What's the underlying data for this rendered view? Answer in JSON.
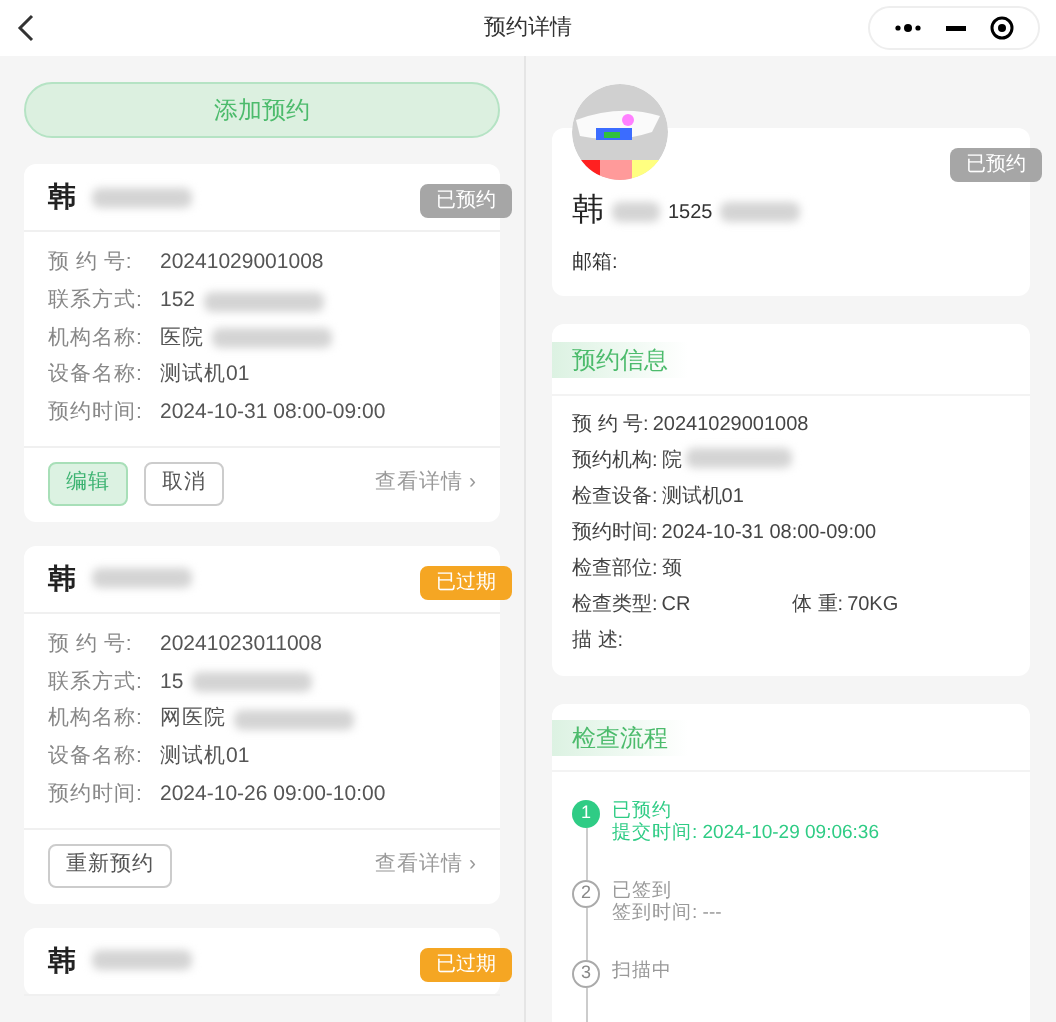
{
  "nav": {
    "title": "预约详情"
  },
  "add_button": "添加预约",
  "appointments": [
    {
      "name": "韩",
      "status": "已预约",
      "kind": "booked",
      "fields": [
        {
          "label": "预 约 号:",
          "value": "20241029001008"
        },
        {
          "label": "联系方式:",
          "value": "152"
        },
        {
          "label": "机构名称:",
          "value": "医院"
        },
        {
          "label": "设备名称:",
          "value": "测试机01"
        },
        {
          "label": "预约时间:",
          "value": "2024-10-31 08:00-09:00"
        }
      ],
      "actions": [
        "编辑",
        "取消"
      ],
      "detail": "查看详情",
      "chevron": "›"
    },
    {
      "name": "韩",
      "status": "已过期",
      "kind": "expired",
      "fields": [
        {
          "label": "预 约 号:",
          "value": "20241023011008"
        },
        {
          "label": "联系方式:",
          "value": "15"
        },
        {
          "label": "机构名称:",
          "value": "网医院"
        },
        {
          "label": "设备名称:",
          "value": "测试机01"
        },
        {
          "label": "预约时间:",
          "value": "2024-10-26 09:00-10:00"
        }
      ],
      "actions": [
        "重新预约"
      ],
      "detail": "查看详情",
      "chevron": "›"
    },
    {
      "name": "韩",
      "status": "已过期",
      "kind": "expired"
    }
  ],
  "profile": {
    "name": "韩",
    "phone": "1525",
    "email_label": "邮箱:",
    "status": "已预约"
  },
  "info": {
    "title": "预约信息",
    "rows": [
      [
        {
          "label": "预 约 号:",
          "value": "20241029001008"
        }
      ],
      [
        {
          "label": "预约机构:",
          "value": "院"
        }
      ],
      [
        {
          "label": "检查设备:",
          "value": "测试机01"
        }
      ],
      [
        {
          "label": "预约时间:",
          "value": "2024-10-31 08:00-09:00"
        }
      ],
      [
        {
          "label": "检查部位:",
          "value": "颈"
        }
      ],
      [
        {
          "label": "检查类型:",
          "value": "CR"
        },
        {
          "label": "体 重:",
          "value": "70KG"
        }
      ],
      [
        {
          "label": "描 述:"
        }
      ]
    ]
  },
  "flow": {
    "title": "检查流程",
    "steps": [
      {
        "number": "1",
        "title": "已预约",
        "time": "提交时间:  2024-10-29 09:06:36",
        "selected": true
      },
      {
        "number": "2",
        "title": "已签到",
        "time": "签到时间:  ---",
        "selected": false
      },
      {
        "number": "3",
        "title": "扫描中",
        "selected": false
      }
    ]
  }
}
